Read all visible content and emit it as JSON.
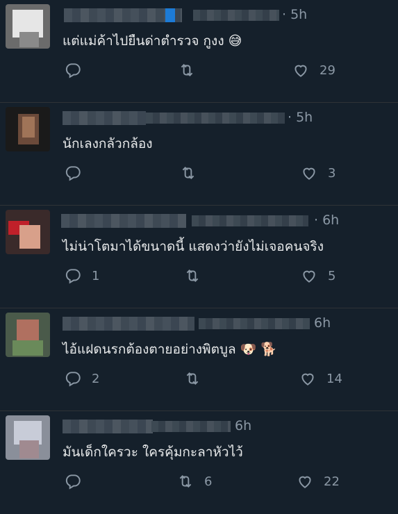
{
  "tweets": [
    {
      "time": "· 5h",
      "text": "แต่แม่ค้าไปยืนด่าตำรวจ กูงง 😅",
      "replies": "",
      "retweets": "",
      "likes": "29",
      "emoji": "sweat-smile"
    },
    {
      "time": "· 5h",
      "text": "นักเลงกลัวกล้อง",
      "replies": "",
      "retweets": "",
      "likes": "3",
      "emoji": ""
    },
    {
      "time": "· 6h",
      "text": "ไม่น่าโตมาได้ขนาดนี้ แสดงว่ายังไม่เจอคนจริง",
      "replies": "1",
      "retweets": "",
      "likes": "5",
      "emoji": ""
    },
    {
      "time": "6h",
      "text": "ไอ้แฝดนรกต้องตายอย่างพิตบูล 🐶 🐕",
      "replies": "2",
      "retweets": "",
      "likes": "14",
      "emoji": "dogs"
    },
    {
      "time": "6h",
      "text": "มันเด็กใครวะ ใครคุ้มกะลาหัวไว้",
      "replies": "",
      "retweets": "6",
      "likes": "22",
      "emoji": ""
    }
  ],
  "icons": {
    "reply": "reply-icon",
    "retweet": "retweet-icon",
    "like": "heart-icon"
  },
  "colors": {
    "background": "#15202b",
    "text": "#e7e9ea",
    "muted": "#8b98a5",
    "divider": "#2f3336"
  }
}
